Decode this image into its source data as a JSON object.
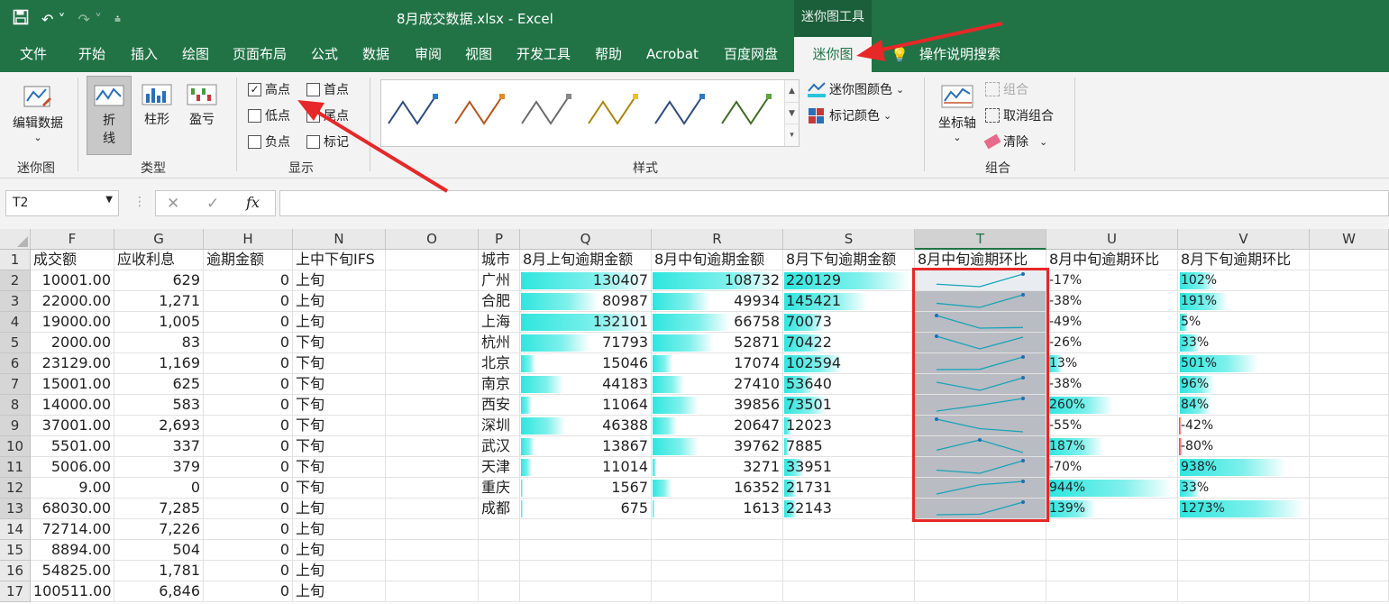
{
  "window": {
    "title": "8月成交数据.xlsx  -  Excel",
    "tool_tab": "迷你图工具"
  },
  "tabs": [
    "文件",
    "开始",
    "插入",
    "绘图",
    "页面布局",
    "公式",
    "数据",
    "审阅",
    "视图",
    "开发工具",
    "帮助",
    "Acrobat",
    "百度网盘",
    "迷你图",
    "操作说明搜索"
  ],
  "ribbon": {
    "edit_data": "编辑数据",
    "group_sparkline": "迷你图",
    "type_line_1": "折",
    "type_line_2": "线",
    "type_column": "柱形",
    "type_winloss": "盈亏",
    "group_type": "类型",
    "cb_high": "高点",
    "cb_first": "首点",
    "cb_low": "低点",
    "cb_last": "尾点",
    "cb_negative": "负点",
    "cb_markers": "标记",
    "group_show": "显示",
    "group_style": "样式",
    "sparkline_color": "迷你图颜色",
    "marker_color": "标记颜色",
    "axis": "坐标轴",
    "group_btn": "组合",
    "ungroup": "取消组合",
    "clear": "清除",
    "group_group": "组合",
    "style_colors": [
      "#2e4a7d",
      "#b5541b",
      "#6b6b6b",
      "#a8870f",
      "#2e4a7d",
      "#3f6b26"
    ]
  },
  "formula_bar": {
    "name_box": "T2",
    "fx": "fx",
    "cancel": "✕",
    "enter": "✓"
  },
  "columns": [
    "F",
    "G",
    "H",
    "N",
    "O",
    "P",
    "Q",
    "R",
    "S",
    "T",
    "U",
    "V",
    "W"
  ],
  "headers": {
    "F": "成交额",
    "G": "应收利息",
    "H": "逾期金额",
    "N": "上中下旬IFS",
    "P": "城市",
    "Q": "8月上旬逾期金额",
    "R": "8月中旬逾期金额",
    "S": "8月下旬逾期金额",
    "T": "8月中旬逾期环比",
    "U": "8月中旬逾期环比",
    "V": "8月下旬逾期环比"
  },
  "row_numbers": [
    "1",
    "2",
    "3",
    "4",
    "5",
    "6",
    "7",
    "8",
    "9",
    "10",
    "11",
    "12",
    "13",
    "14",
    "15",
    "16",
    "17"
  ],
  "left_rows": [
    [
      "10001.00",
      "629",
      "0",
      "上旬"
    ],
    [
      "22000.00",
      "1,271",
      "0",
      "上旬"
    ],
    [
      "19000.00",
      "1,005",
      "0",
      "上旬"
    ],
    [
      "2000.00",
      "83",
      "0",
      "下旬"
    ],
    [
      "23129.00",
      "1,169",
      "0",
      "下旬"
    ],
    [
      "15001.00",
      "625",
      "0",
      "下旬"
    ],
    [
      "14000.00",
      "583",
      "0",
      "下旬"
    ],
    [
      "37001.00",
      "2,693",
      "0",
      "下旬"
    ],
    [
      "5501.00",
      "337",
      "0",
      "下旬"
    ],
    [
      "5006.00",
      "379",
      "0",
      "下旬"
    ],
    [
      "9.00",
      "0",
      "0",
      "下旬"
    ],
    [
      "68030.00",
      "7,285",
      "0",
      "上旬"
    ],
    [
      "72714.00",
      "7,226",
      "0",
      "上旬"
    ],
    [
      "8894.00",
      "504",
      "0",
      "上旬"
    ],
    [
      "54825.00",
      "1,781",
      "0",
      "上旬"
    ],
    [
      "100511.00",
      "6,846",
      "0",
      "上旬"
    ]
  ],
  "city_rows": [
    {
      "city": "广州",
      "q": "130407",
      "r": "108732",
      "s": "220129",
      "u": "-17%",
      "v": "102%"
    },
    {
      "city": "合肥",
      "q": "80987",
      "r": "49934",
      "s": "145421",
      "u": "-38%",
      "v": "191%"
    },
    {
      "city": "上海",
      "q": "132101",
      "r": "66758",
      "s": "70073",
      "u": "-49%",
      "v": "5%"
    },
    {
      "city": "杭州",
      "q": "71793",
      "r": "52871",
      "s": "70422",
      "u": "-26%",
      "v": "33%"
    },
    {
      "city": "北京",
      "q": "15046",
      "r": "17074",
      "s": "102594",
      "u": "13%",
      "v": "501%"
    },
    {
      "city": "南京",
      "q": "44183",
      "r": "27410",
      "s": "53640",
      "u": "-38%",
      "v": "96%"
    },
    {
      "city": "西安",
      "q": "11064",
      "r": "39856",
      "s": "73501",
      "u": "260%",
      "v": "84%"
    },
    {
      "city": "深圳",
      "q": "46388",
      "r": "20647",
      "s": "12023",
      "u": "-55%",
      "v": "-42%"
    },
    {
      "city": "武汉",
      "q": "13867",
      "r": "39762",
      "s": "7885",
      "u": "187%",
      "v": "-80%"
    },
    {
      "city": "天津",
      "q": "11014",
      "r": "3271",
      "s": "33951",
      "u": "-70%",
      "v": "938%"
    },
    {
      "city": "重庆",
      "q": "1567",
      "r": "16352",
      "s": "21731",
      "u": "944%",
      "v": "33%"
    },
    {
      "city": "成都",
      "q": "675",
      "r": "1613",
      "s": "22143",
      "u": "139%",
      "v": "1273%"
    }
  ]
}
